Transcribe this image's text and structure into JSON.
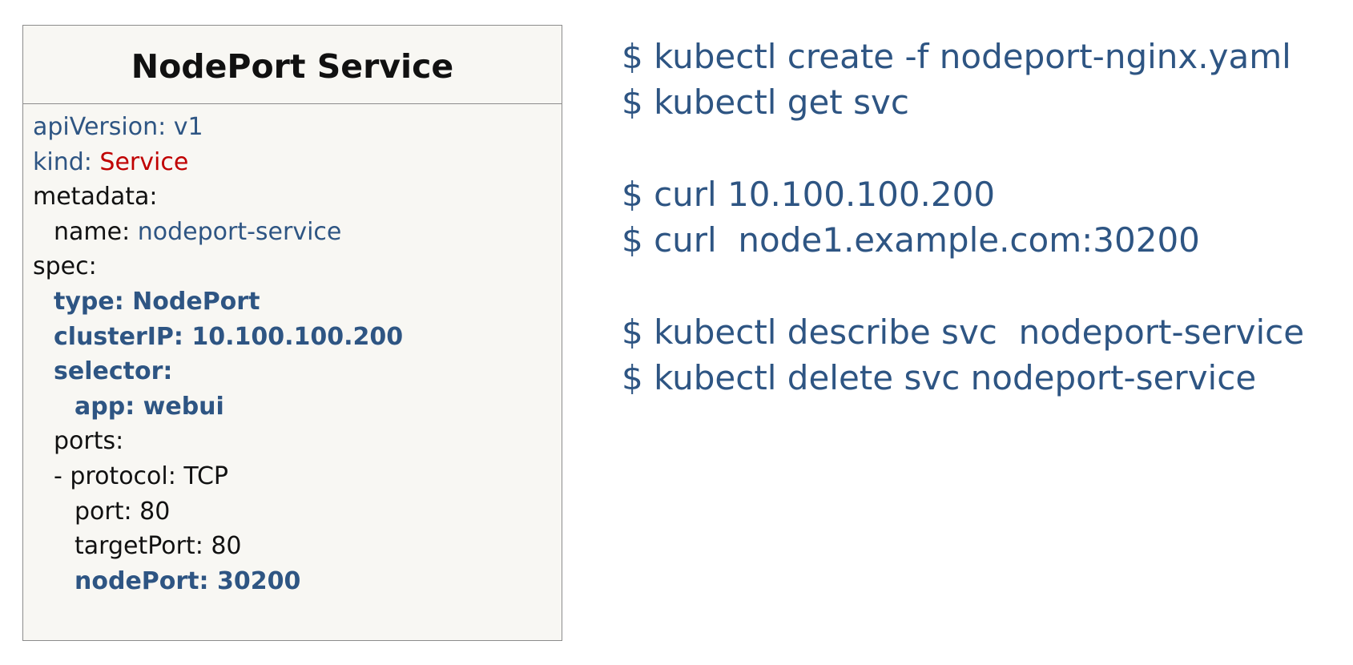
{
  "yaml_panel": {
    "title": "NodePort Service",
    "lines": {
      "api_key": "apiVersion: ",
      "api_val": "v1",
      "kind_key": "kind: ",
      "kind_val": "Service",
      "metadata_key": "metadata:",
      "name_key": "name: ",
      "name_val": "nodeport-service",
      "spec_key": "spec:",
      "type_line": "type: NodePort",
      "clusterip_line": "clusterIP: 10.100.100.200",
      "selector_line": "selector:",
      "app_line": "app: webui",
      "ports_key": "ports:",
      "protocol_line": "- protocol: TCP",
      "port_line": "port: 80",
      "targetport_line": "targetPort: 80",
      "nodeport_line": "nodePort: 30200"
    }
  },
  "commands": {
    "group1": [
      "$ kubectl create -f nodeport-nginx.yaml",
      "$ kubectl get svc"
    ],
    "group2": [
      "$ curl 10.100.100.200",
      "$ curl  node1.example.com:30200"
    ],
    "group3": [
      "$ kubectl describe svc  nodeport-service",
      "$ kubectl delete svc nodeport-service"
    ]
  },
  "colors": {
    "text_blue": "#2e5583",
    "value_red": "#c00000",
    "panel_background": "#f8f7f3",
    "panel_border": "#8c8c8c"
  }
}
